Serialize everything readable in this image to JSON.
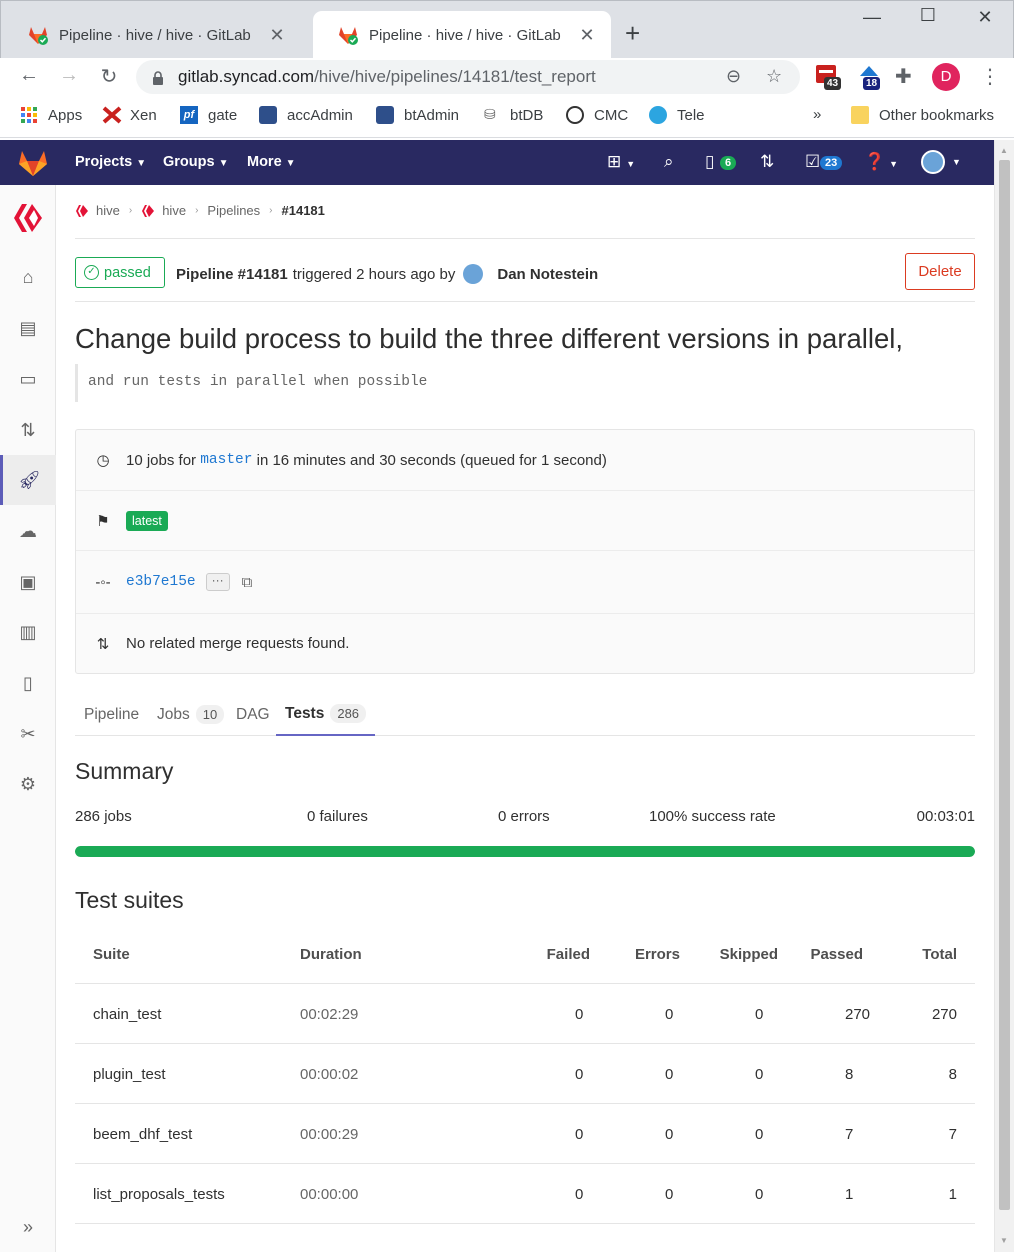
{
  "browser": {
    "tabs": [
      {
        "title": "Pipeline · hive / hive · GitLab",
        "active": false
      },
      {
        "title": "Pipeline · hive / hive · GitLab",
        "active": true
      }
    ],
    "url_host": "gitlab.syncad.com",
    "url_path": "/hive/hive/pipelines/14181/test_report",
    "extensions": {
      "ext1_badge": "43",
      "ext2_badge": "18",
      "profile_initial": "D"
    },
    "bookmarks": [
      {
        "label": "Apps",
        "icon": "apps-grid-icon"
      },
      {
        "label": "Xen",
        "icon": "xen-icon"
      },
      {
        "label": "gate",
        "icon": "pf-icon"
      },
      {
        "label": "accAdmin",
        "icon": "admin-icon"
      },
      {
        "label": "btAdmin",
        "icon": "admin-icon"
      },
      {
        "label": "btDB",
        "icon": "db-icon"
      },
      {
        "label": "CMC",
        "icon": "cmc-icon"
      },
      {
        "label": "Tele",
        "icon": "telegram-icon"
      }
    ],
    "bookmarks_overflow": "»",
    "other_bookmarks": "Other bookmarks"
  },
  "gitlab_nav": {
    "menus": [
      "Projects",
      "Groups",
      "More"
    ],
    "issues_count": "6",
    "todos_count": "23"
  },
  "breadcrumb": {
    "items": [
      "hive",
      "hive",
      "Pipelines"
    ],
    "current": "#14181"
  },
  "pipeline_header": {
    "status": "passed",
    "pipeline_label": "Pipeline #14181",
    "triggered_text": "triggered 2 hours ago by",
    "author": "Dan Notestein",
    "delete_label": "Delete"
  },
  "commit": {
    "title": "Change build process to build the three different versions in parallel,",
    "description": "and run tests in parallel when possible"
  },
  "info": {
    "jobs_prefix": "10 jobs for",
    "branch": "master",
    "jobs_suffix": "in 16 minutes and 30 seconds (queued for 1 second)",
    "tag": "latest",
    "sha": "e3b7e15e",
    "ellipsis": "···",
    "merge_requests": "No related merge requests found."
  },
  "pipeline_tabs": [
    {
      "label": "Pipeline",
      "count": ""
    },
    {
      "label": "Jobs",
      "count": "10"
    },
    {
      "label": "DAG",
      "count": ""
    },
    {
      "label": "Tests",
      "count": "286"
    }
  ],
  "summary": {
    "heading": "Summary",
    "jobs": "286 jobs",
    "failures": "0 failures",
    "errors": "0 errors",
    "success_rate": "100% success rate",
    "duration": "00:03:01",
    "success_fraction": 1.0
  },
  "suites": {
    "heading": "Test suites",
    "columns": [
      "Suite",
      "Duration",
      "Failed",
      "Errors",
      "Skipped",
      "Passed",
      "Total"
    ],
    "rows": [
      [
        "chain_test",
        "00:02:29",
        "0",
        "0",
        "0",
        "270",
        "270"
      ],
      [
        "plugin_test",
        "00:00:02",
        "0",
        "0",
        "0",
        "8",
        "8"
      ],
      [
        "beem_dhf_test",
        "00:00:29",
        "0",
        "0",
        "0",
        "7",
        "7"
      ],
      [
        "list_proposals_tests",
        "00:00:00",
        "0",
        "0",
        "0",
        "1",
        "1"
      ]
    ]
  },
  "colors": {
    "nav_bg": "#292961",
    "success": "#1aaa55",
    "danger": "#db3b21",
    "link": "#1f78d1"
  }
}
